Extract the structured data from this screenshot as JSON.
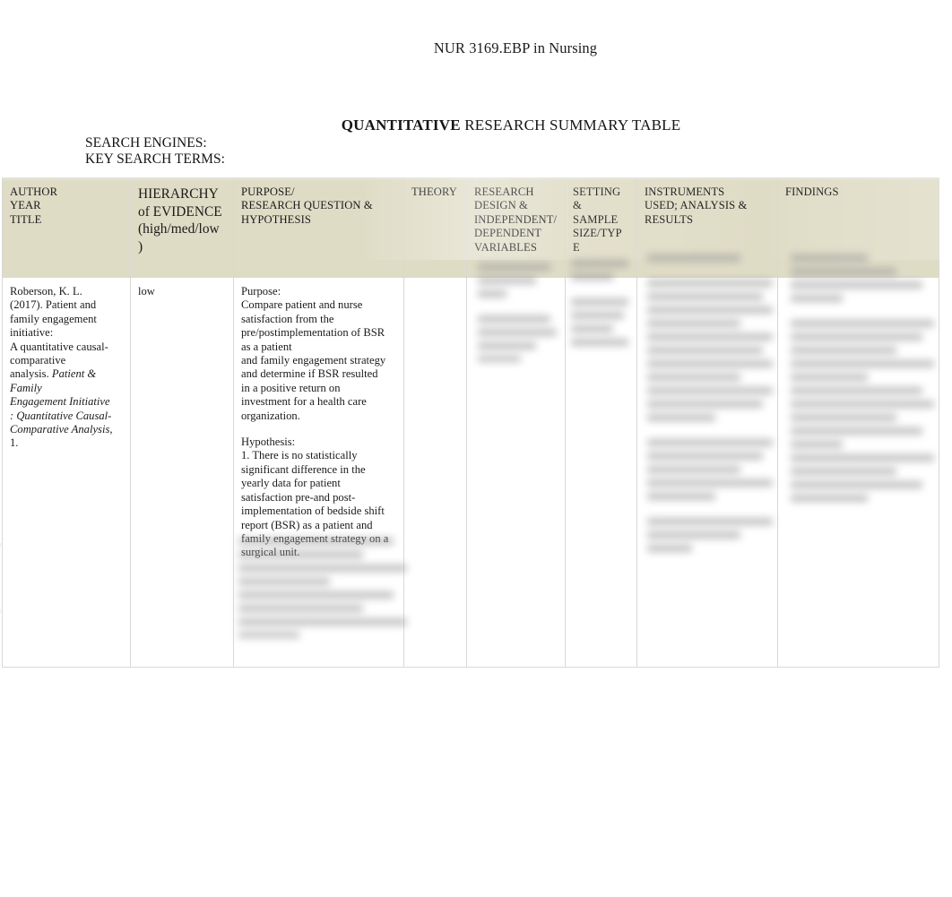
{
  "document": {
    "course_title": "NUR 3169.EBP in Nursing",
    "table_title_bold": "QUANTITATIVE",
    "table_title_rest": " RESEARCH SUMMARY TABLE"
  },
  "search": {
    "engines_label": "SEARCH ENGINES:",
    "terms_label": "KEY SEARCH TERMS:"
  },
  "table": {
    "headers": [
      "AUTHOR\nYEAR\nTITLE",
      "HIERARCHY\nof EVIDENCE\n(high/med/low\n)",
      "PURPOSE/\nRESEARCH QUESTION &\nHYPOTHESIS",
      "THEORY",
      "RESEARCH\nDESIGN &\nINDEPENDENT/\nDEPENDENT\nVARIABLES",
      "SETTING\n&\nSAMPLE\nSIZE/TYP\nE",
      "INSTRUMENTS\nUSED; ANALYSIS &\nRESULTS",
      "FINDINGS"
    ],
    "rows": [
      {
        "author_year_title_plain1": "Roberson, K. L.\n(2017). Patient and\nfamily engagement\ninitiative:\nA quantitative causal-\ncomparative\nanalysis. ",
        "author_year_title_italic": "Patient &\nFamily\nEngagement Initiative\n: Quantitative Causal-\nComparative Analysis",
        "author_year_title_plain2": ",\n1.",
        "hierarchy": "low",
        "purpose_heading": "Purpose:",
        "purpose_body": "Compare patient and nurse\nsatisfaction from the\npre/postimplementation of BSR\nas a patient\nand family engagement strategy\nand determine if BSR resulted\nin a positive return on\ninvestment for a health care\norganization.",
        "hypothesis_heading": "Hypothesis:",
        "hypothesis_body": "1. There is no statistically\nsignificant difference in the\nyearly data for patient\nsatisfaction pre-and post-\nimplementation of bedside shift\nreport (BSR) as a patient and\nfamily engagement strategy on a\nsurgical unit.",
        "theory": "",
        "research_design": "",
        "setting_sample": "",
        "instruments": "",
        "findings": ""
      }
    ]
  },
  "colors": {
    "header_background": "#dfdcc6",
    "border": "#d8d8d4",
    "text": "#1a1a1a",
    "page_background": "#ffffff"
  }
}
